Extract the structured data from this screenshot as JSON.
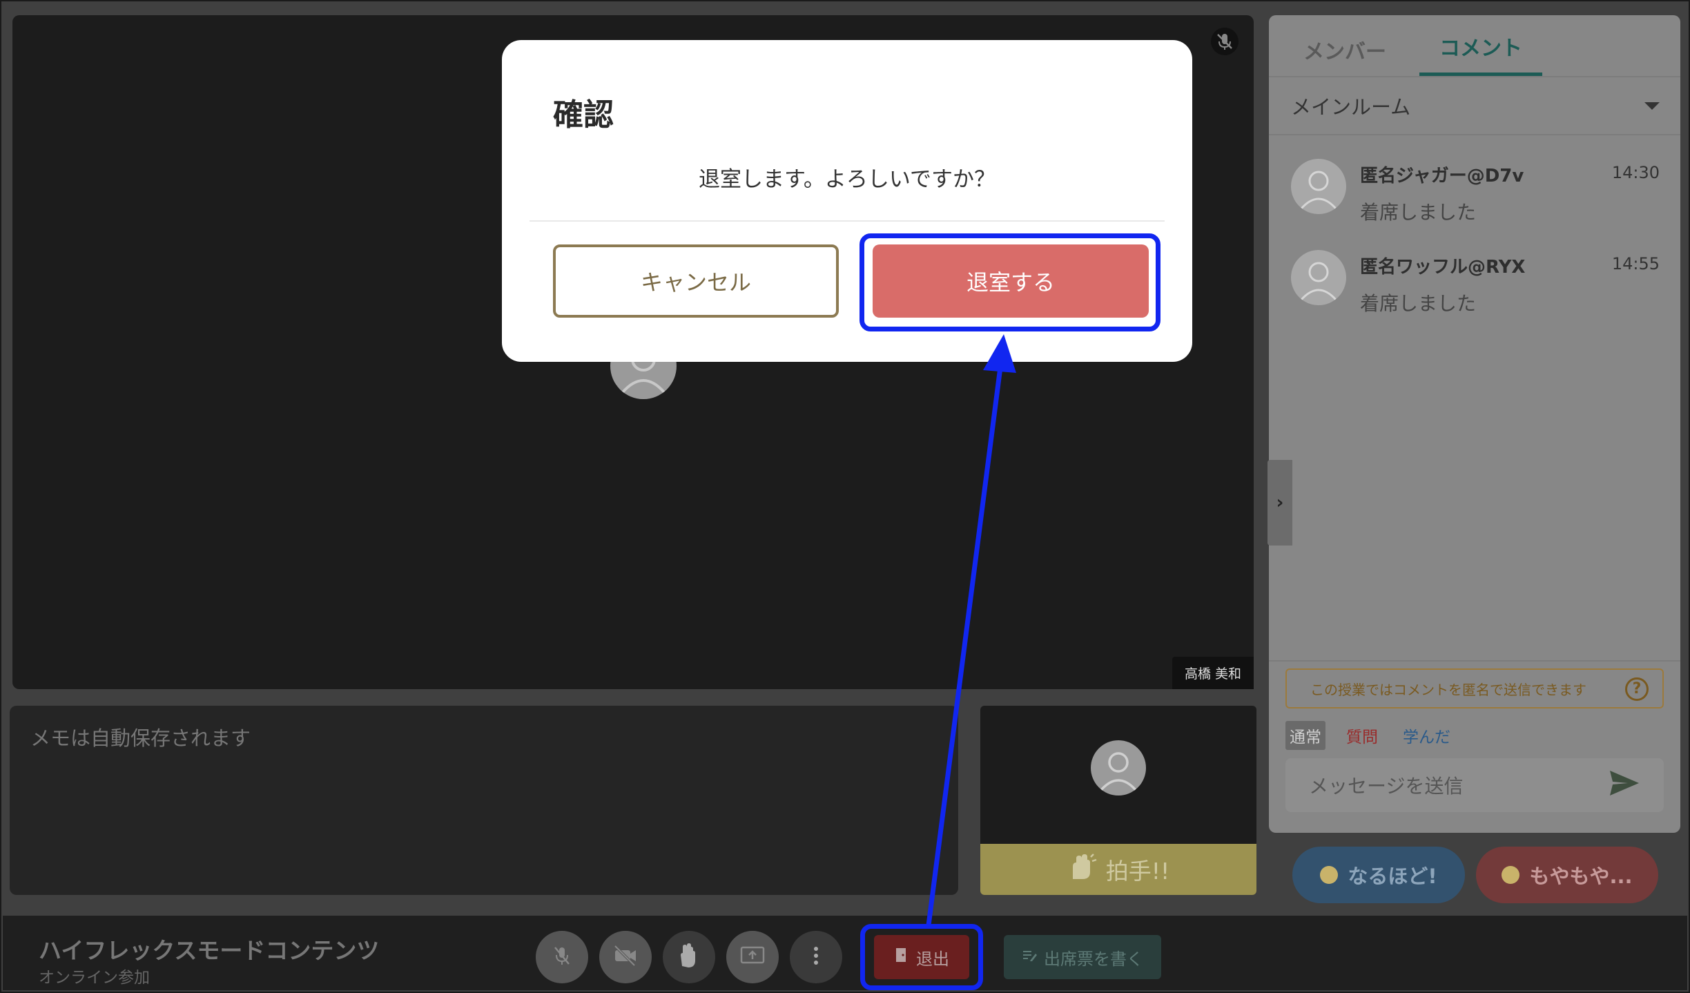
{
  "main_video": {
    "participant_name": "高橋 美和"
  },
  "memo": {
    "placeholder": "メモは自動保存されます"
  },
  "self_tile": {
    "clap_label": "拍手!!"
  },
  "panel": {
    "tabs": [
      {
        "label": "メンバー",
        "active": false
      },
      {
        "label": "コメント",
        "active": true
      }
    ],
    "room": "メインルーム",
    "messages": [
      {
        "user": "匿名ジャガー@D7v",
        "time": "14:30",
        "text": "着席しました"
      },
      {
        "user": "匿名ワッフル@RYX",
        "time": "14:55",
        "text": "着席しました"
      }
    ],
    "anon_notice": "この授業ではコメントを匿名で送信できます",
    "help_icon": "?",
    "message_types": [
      "通常",
      "質問",
      "学んだ"
    ],
    "input_placeholder": "メッセージを送信"
  },
  "reactions": {
    "naruhodo": "なるほど!",
    "moyamoya": "もやもや..."
  },
  "bottom_bar": {
    "course_title": "ハイフレックスモードコンテンツ",
    "mode": "オンライン参加",
    "leave_label": "退出",
    "attendance_label": "出席票を書く"
  },
  "modal": {
    "title": "確認",
    "body": "退室します。よろしいですか？",
    "cancel_label": "キャンセル",
    "confirm_label": "退室する"
  },
  "colors": {
    "highlight": "#1126f0",
    "confirm": "#d96c69",
    "accent": "#1c5b55"
  }
}
